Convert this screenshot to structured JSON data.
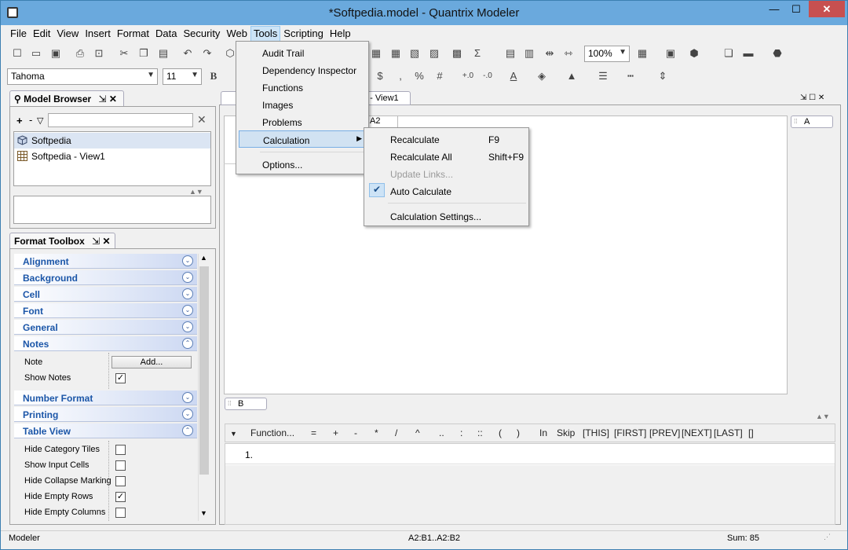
{
  "window": {
    "title": "*Softpedia.model - Quantrix Modeler",
    "minimize": "—",
    "maximize": "☐",
    "close": "✕"
  },
  "menubar": [
    "File",
    "Edit",
    "View",
    "Insert",
    "Format",
    "Data",
    "Security",
    "Web",
    "Tools",
    "Scripting",
    "Help"
  ],
  "toolbar": {
    "font_name": "Tahoma",
    "font_size": "11",
    "zoom": "100%"
  },
  "model_browser": {
    "title": "Model Browser",
    "add": "+",
    "remove": "-",
    "items": [
      {
        "label": "Softpedia",
        "icon": "cube-icon",
        "selected": true
      },
      {
        "label": "Softpedia - View1",
        "icon": "grid-icon",
        "selected": false
      }
    ]
  },
  "format_toolbox": {
    "title": "Format Toolbox",
    "sections_top": [
      "Alignment",
      "Background",
      "Cell",
      "Font",
      "General"
    ],
    "notes_section": "Notes",
    "note_label": "Note",
    "note_button": "Add...",
    "show_notes_label": "Show Notes",
    "show_notes_checked": true,
    "sections_mid": [
      "Number Format",
      "Printing"
    ],
    "table_view_section": "Table View",
    "table_view_props": [
      {
        "label": "Hide Category Tiles",
        "checked": false
      },
      {
        "label": "Show Input Cells",
        "checked": false
      },
      {
        "label": "Hide Collapse Marking",
        "checked": false
      },
      {
        "label": "Hide Empty Rows",
        "checked": true
      },
      {
        "label": "Hide Empty Columns",
        "checked": false
      }
    ]
  },
  "view": {
    "tab_label": "a - View1",
    "cell_ref": "A2",
    "column_tile": "A",
    "row_tile": "B"
  },
  "tools_menu": {
    "items": [
      "Audit Trail",
      "Dependency Inspector",
      "Functions",
      "Images",
      "Problems",
      "Calculation",
      "Options..."
    ]
  },
  "calculation_menu": {
    "recalculate": "Recalculate",
    "recalculate_sc": "F9",
    "recalculate_all": "Recalculate All",
    "recalculate_all_sc": "Shift+F9",
    "update_links": "Update Links...",
    "auto_calculate": "Auto Calculate",
    "auto_calculate_checked": true,
    "settings": "Calculation Settings..."
  },
  "formula_bar": {
    "buttons": [
      "Function...",
      "=",
      "+",
      "-",
      "*",
      "/",
      "^",
      "..",
      ":",
      "::",
      "(",
      ")",
      "In",
      "Skip",
      "[THIS]",
      "[FIRST]",
      "[PREV]",
      "[NEXT]",
      "[LAST]",
      "[]"
    ],
    "line_number": "1."
  },
  "statusbar": {
    "left": "Modeler",
    "range": "A2:B1..A2:B2",
    "sum": "Sum: 85"
  }
}
